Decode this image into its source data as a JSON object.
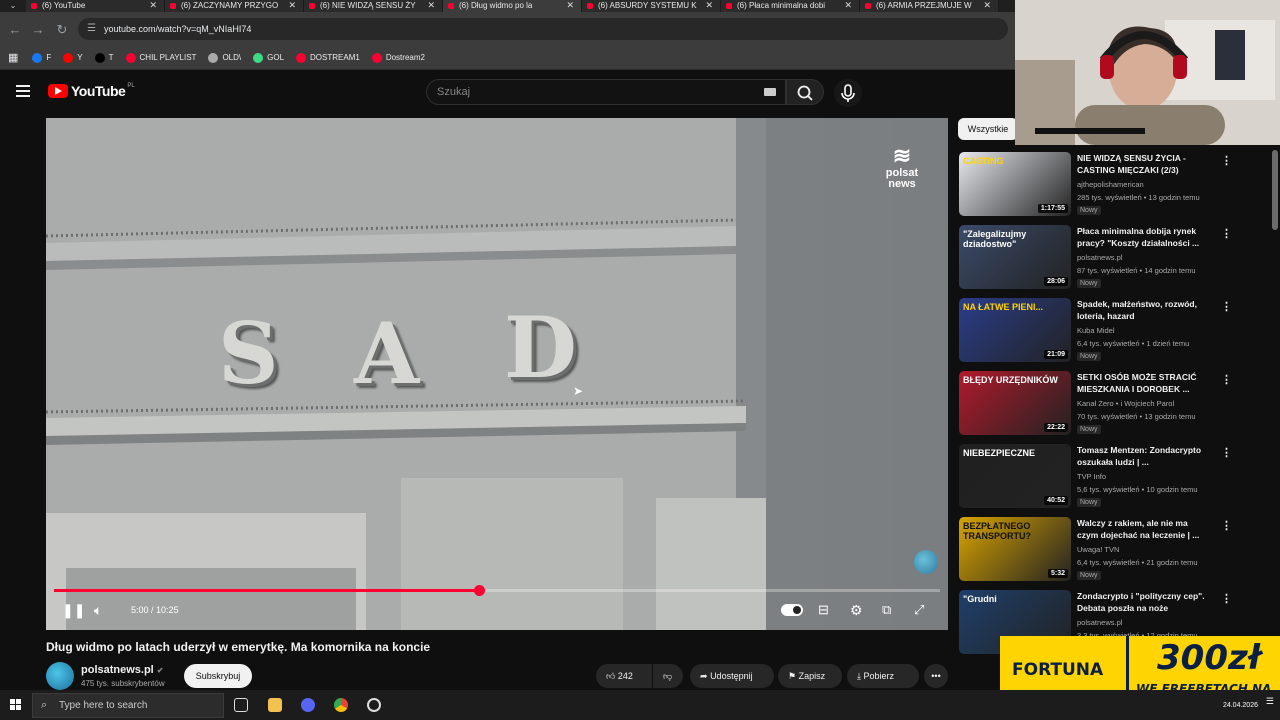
{
  "browser": {
    "tabs": [
      {
        "label": "(6) YouTube",
        "active": false
      },
      {
        "label": "(6) ZACZYNAMY PRZYGO",
        "active": false
      },
      {
        "label": "(6) NIE WIDZĄ SENSU ŻY",
        "active": false
      },
      {
        "label": "(6) Dług widmo po la",
        "active": true
      },
      {
        "label": "(6) ABSURDY SYSTEMU K",
        "active": false
      },
      {
        "label": "(6) Płaca minimalna dobi",
        "active": false
      },
      {
        "label": "(6) ARMIA PRZEJMUJE W",
        "active": false
      }
    ],
    "url": "youtube.com/watch?v=qM_vNIaHI74",
    "bookmarks": [
      {
        "label": "F",
        "color": "#1877f2"
      },
      {
        "label": "Y",
        "color": "#ff0000"
      },
      {
        "label": "T",
        "color": "#000000"
      },
      {
        "label": "CHIL PLAYLIST",
        "color": "#ff0033"
      },
      {
        "label": "OLD\\",
        "color": "#aaaaaa"
      },
      {
        "label": "GOL",
        "color": "#3ddc84"
      },
      {
        "label": "DOSTREAM1",
        "color": "#ff0033"
      },
      {
        "label": "Dostream2",
        "color": "#ff0033"
      }
    ]
  },
  "youtube": {
    "logo_text": "YouTube",
    "country_code": "PL",
    "search_placeholder": "Szukaj"
  },
  "video": {
    "watermark": "polsat news",
    "building_text": [
      "S",
      "A",
      "D"
    ],
    "current_time": "5:00",
    "duration": "10:25",
    "progress": 0.48,
    "title": "Dług widmo po latach uderzył w emerytkę. Ma komornika na koncie",
    "channel": "polsatnews.pl",
    "subscribers": "475 tys. subskrybentów",
    "subscribe_label": "Subskrybuj",
    "likes": "242",
    "share_label": "Udostępnij",
    "save_label": "Zapisz",
    "download_label": "Pobierz"
  },
  "sidebar": {
    "chip": "Wszystkie",
    "recommendations": [
      {
        "title": "NIE WIDZĄ SENSU ŻYCIA - CASTING MIĘCZAKI (2/3)",
        "channel": "ajthepolishamerican",
        "meta": "285 tys. wyświetleń • 13 godzin temu",
        "badge": "Nowy",
        "duration": "1:17:55",
        "thumb_text": "CASTING",
        "thumb_color": "#e7e9ee",
        "thumb_accent": "#ffd400"
      },
      {
        "title": "Płaca minimalna dobija rynek pracy? \"Koszty działalności ...",
        "channel": "polsatnews.pl",
        "meta": "87 tys. wyświetleń • 14 godzin temu",
        "badge": "Nowy",
        "duration": "28:06",
        "thumb_text": "\"Zalegalizujmy dziadostwo\"",
        "thumb_color": "#3b4b6a",
        "thumb_accent": "#ffffff"
      },
      {
        "title": "Spadek, małżeństwo, rozwód, loteria, hazard",
        "channel": "Kuba Midel",
        "meta": "6,4 tys. wyświetleń • 1 dzień temu",
        "badge": "Nowy",
        "duration": "21:09",
        "thumb_text": "NA ŁATWE PIENI...",
        "thumb_color": "#2a3d8a",
        "thumb_accent": "#ffd400"
      },
      {
        "title": "SETKI OSÓB MOŻE STRACIĆ MIESZKANIA I DOROBEK ...",
        "channel": "Kanał Zero • i Wojciech Parol",
        "meta": "70 tys. wyświetleń • 13 godzin temu",
        "badge": "Nowy",
        "duration": "22:22",
        "thumb_text": "BŁĘDY URZĘDNIKÓW",
        "thumb_color": "#b11a2b",
        "thumb_accent": "#ffffff"
      },
      {
        "title": "Tomasz Mentzen: Zondacrypto oszukała ludzi | ...",
        "channel": "TVP Info",
        "meta": "5,6 tys. wyświetleń • 10 godzin temu",
        "badge": "Nowy",
        "duration": "40:52",
        "thumb_text": "NIEBEZPIECZNE",
        "thumb_color": "#202020",
        "thumb_accent": "#ffffff"
      },
      {
        "title": "Walczy z rakiem, ale nie ma czym dojechać na leczenie | ...",
        "channel": "Uwaga! TVN",
        "meta": "6,4 tys. wyświetleń • 21 godzin temu",
        "badge": "Nowy",
        "duration": "5:32",
        "thumb_text": "BEZPŁATNEGO TRANSPORTU?",
        "thumb_color": "#d9a400",
        "thumb_accent": "#111111"
      },
      {
        "title": "Zondacrypto i \"polityczny cep\". Debata poszła na noże",
        "channel": "polsatnews.pl",
        "meta": "3,3 tys. wyświetleń • 12 godzin temu",
        "badge": "",
        "duration": "",
        "thumb_text": "\"Grudni",
        "thumb_color": "#1f3f6b",
        "thumb_accent": "#ffffff"
      }
    ]
  },
  "ad": {
    "brand": "FORTUNA",
    "amount": "300zł",
    "tagline": "WE FREEBETACH NA START"
  },
  "taskbar": {
    "search_placeholder": "Type here to search",
    "date": "24.04.2026"
  },
  "colors": {
    "accent": "#ff0033",
    "background": "#0f0f0f",
    "ad_yellow": "#ffd400"
  }
}
